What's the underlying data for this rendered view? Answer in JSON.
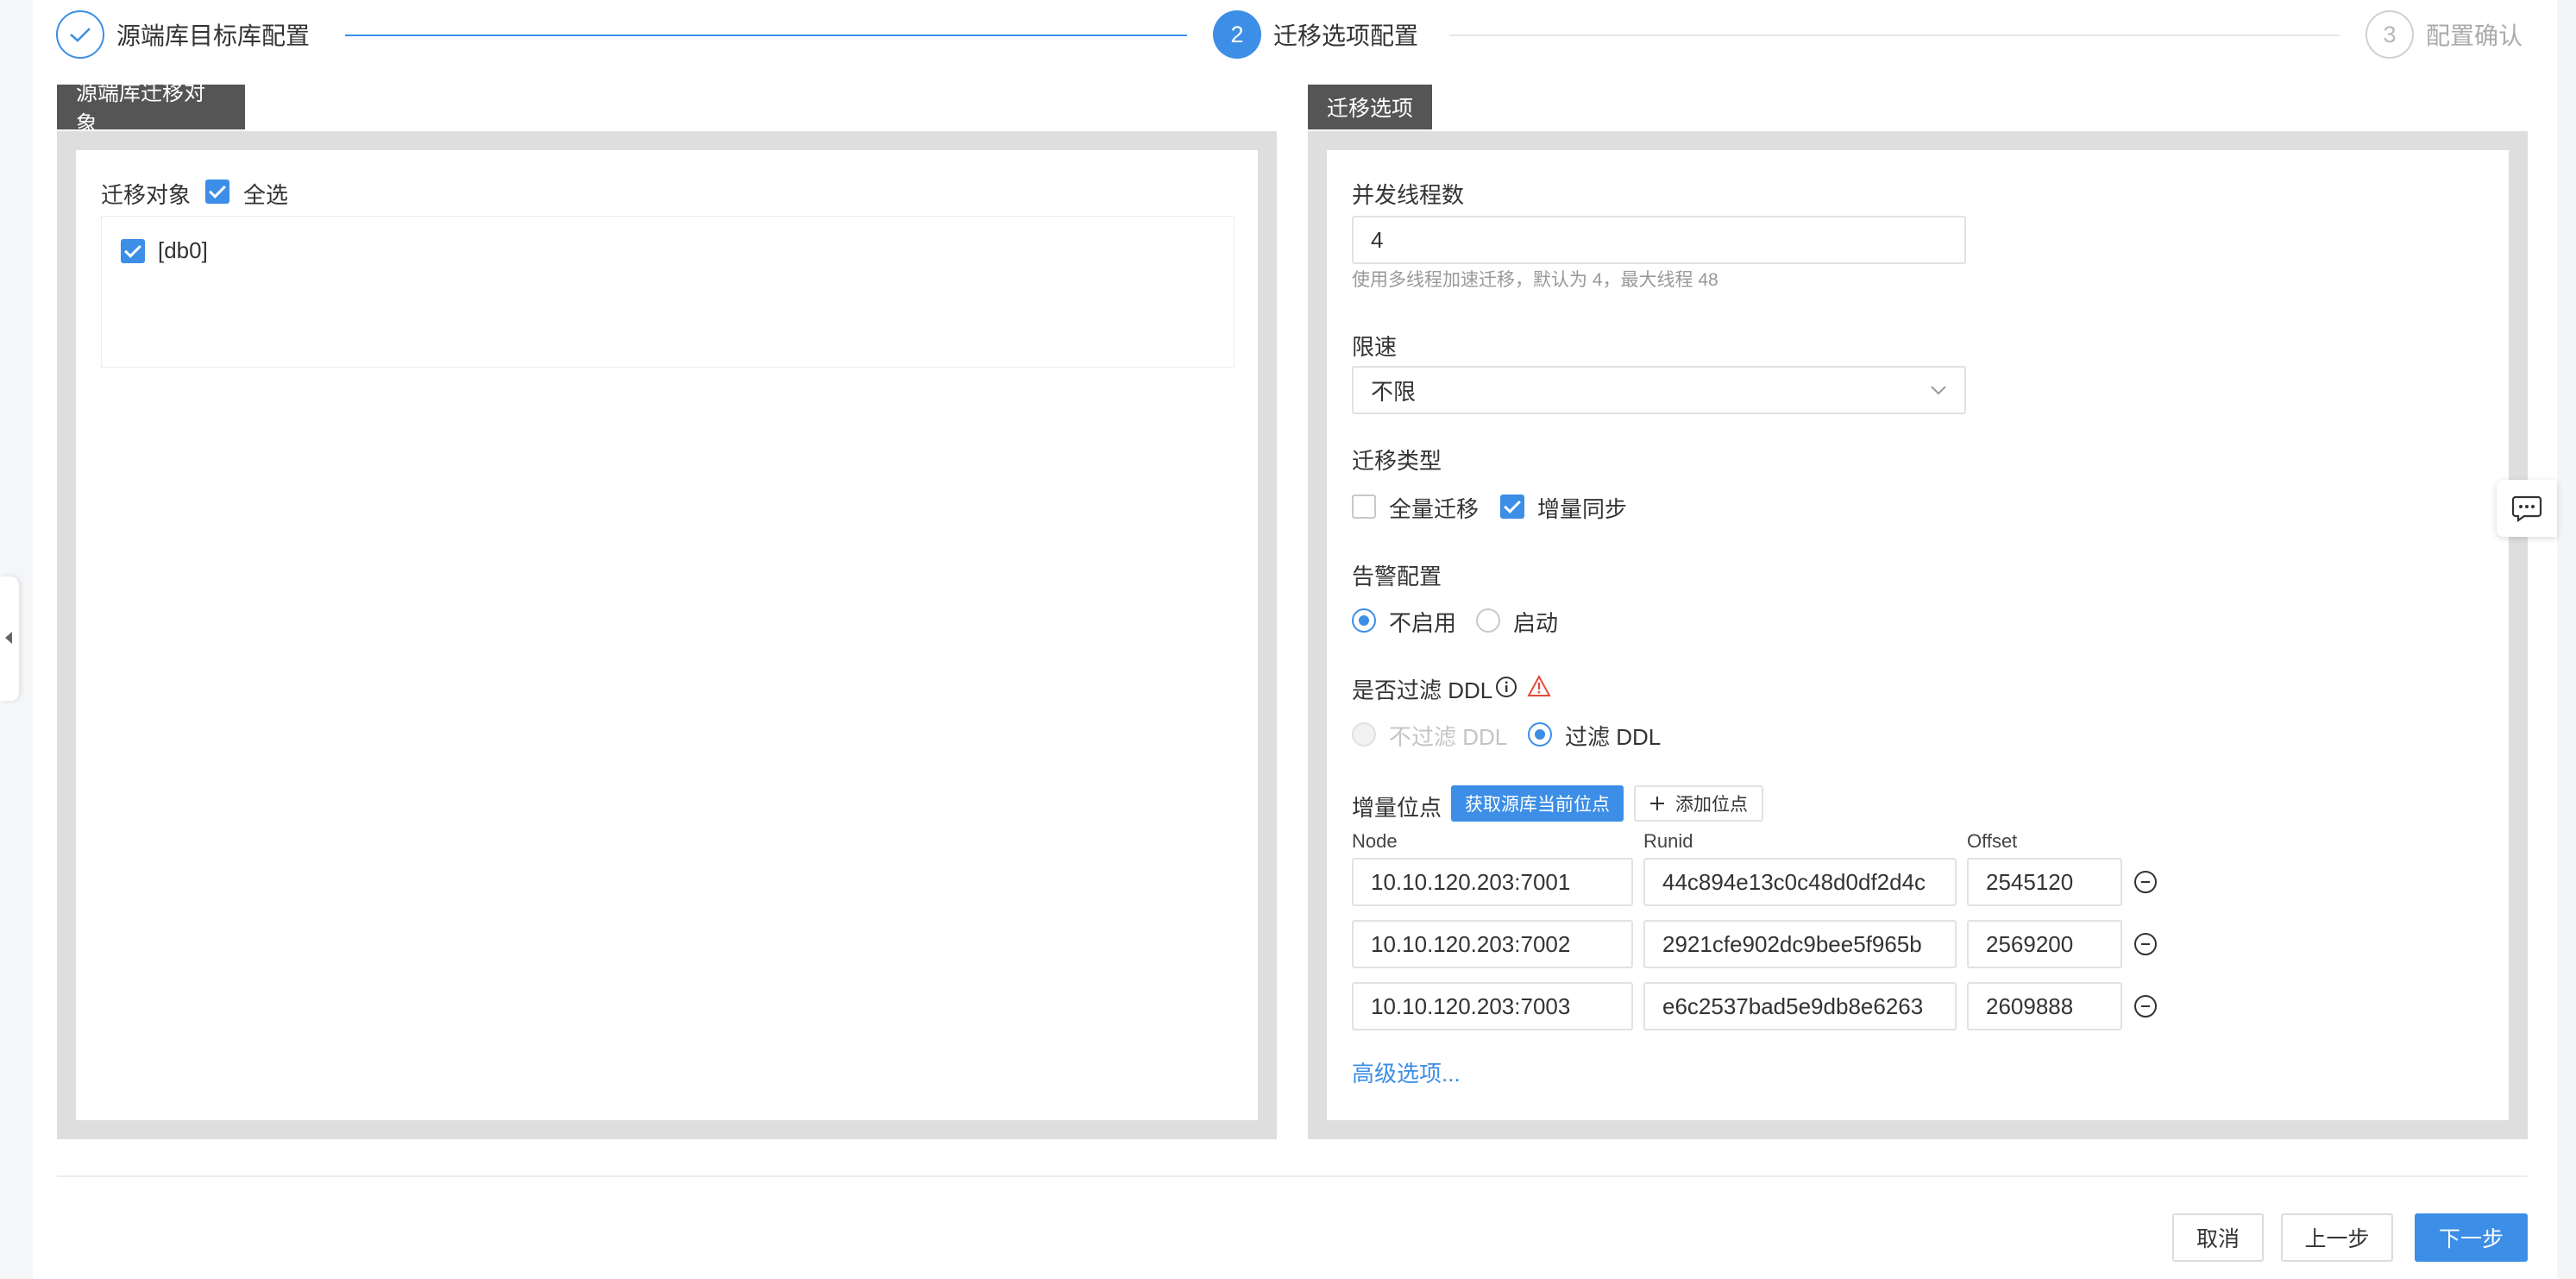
{
  "steps": [
    {
      "number": "",
      "label": "源端库目标库配置",
      "status": "done"
    },
    {
      "number": "2",
      "label": "迁移选项配置",
      "status": "active"
    },
    {
      "number": "3",
      "label": "配置确认",
      "status": "pending"
    }
  ],
  "left_panel": {
    "tab": "源端库迁移对象",
    "objects_label": "迁移对象",
    "select_all_label": "全选",
    "select_all_checked": true,
    "objects": [
      {
        "label": "[db0]",
        "checked": true
      }
    ]
  },
  "right_panel": {
    "tab": "迁移选项",
    "threads": {
      "label": "并发线程数",
      "value": "4",
      "hint": "使用多线程加速迁移，默认为 4，最大线程 48"
    },
    "speed_limit": {
      "label": "限速",
      "value": "不限"
    },
    "migration_type": {
      "label": "迁移类型",
      "options": [
        {
          "label": "全量迁移",
          "checked": false
        },
        {
          "label": "增量同步",
          "checked": true
        }
      ]
    },
    "alert_config": {
      "label": "告警配置",
      "options": [
        {
          "label": "不启用",
          "selected": true
        },
        {
          "label": "启动",
          "selected": false
        }
      ]
    },
    "ddl_filter": {
      "label": "是否过滤 DDL",
      "options": [
        {
          "label": "不过滤 DDL",
          "selected": false,
          "disabled": true
        },
        {
          "label": "过滤 DDL",
          "selected": true,
          "disabled": false
        }
      ]
    },
    "incremental_position": {
      "label": "增量位点",
      "fetch_button": "获取源库当前位点",
      "add_button": "添加位点",
      "columns": [
        "Node",
        "Runid",
        "Offset"
      ],
      "rows": [
        {
          "node": "10.10.120.203:7001",
          "runid": "44c894e13c0c48d0df2d4c",
          "offset": "2545120"
        },
        {
          "node": "10.10.120.203:7002",
          "runid": "2921cfe902dc9bee5f965b",
          "offset": "2569200"
        },
        {
          "node": "10.10.120.203:7003",
          "runid": "e6c2537bad5e9db8e6263",
          "offset": "2609888"
        }
      ]
    },
    "advanced_link": "高级选项..."
  },
  "footer": {
    "cancel": "取消",
    "prev": "上一步",
    "next": "下一步"
  },
  "colors": {
    "accent": "#3c8ee6",
    "tab_header": "#555555",
    "panel_border": "#dedede",
    "warning": "#e64a3b"
  }
}
